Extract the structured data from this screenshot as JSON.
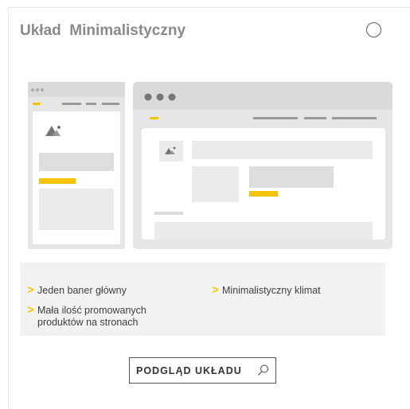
{
  "header": {
    "title": "Układ  Minimalistyczny",
    "select_icon": "radio-circle-icon"
  },
  "features": {
    "items": [
      {
        "arrow": ">",
        "text": "Jeden baner główny"
      },
      {
        "arrow": ">",
        "text": "Minimalistyczny klimat"
      },
      {
        "arrow": ">",
        "text": "Mała ilość promowanych produktów na stronach"
      }
    ]
  },
  "preview": {
    "label": "PODGLĄD UKŁADU",
    "icon": "search-icon"
  },
  "colors": {
    "accent": "#f5c400",
    "mock_gray": "#dedede",
    "panel": "#f2f2f2"
  }
}
